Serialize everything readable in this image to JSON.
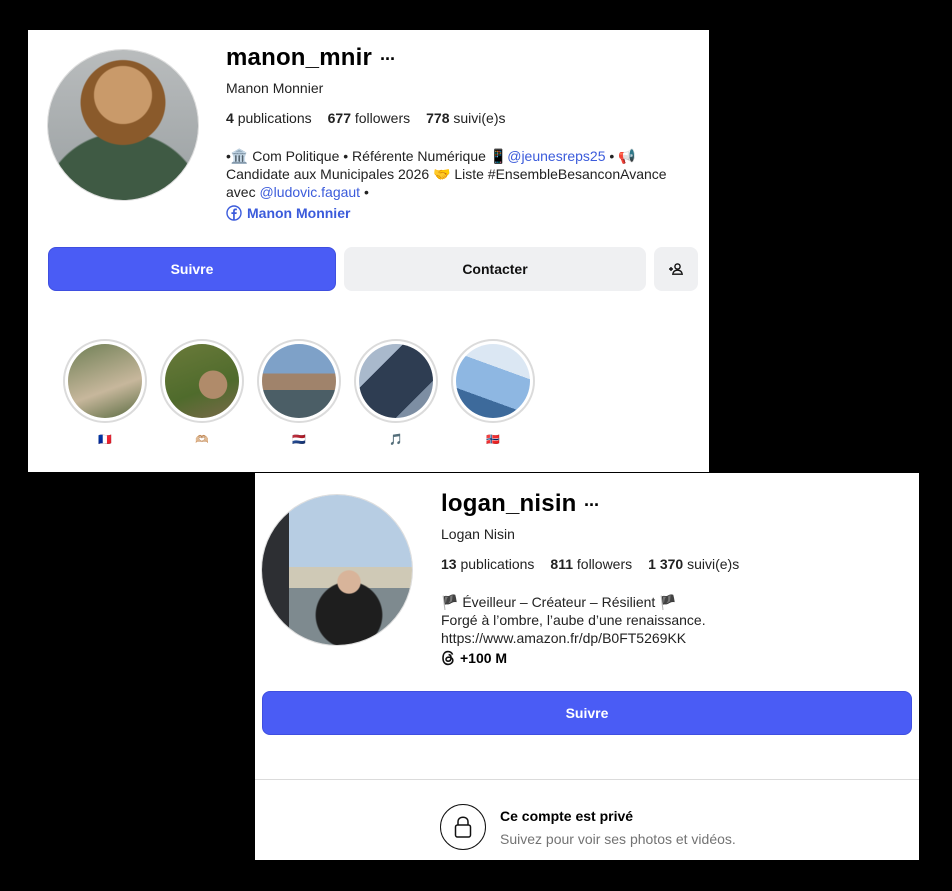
{
  "profile1": {
    "username": "manon_mnir",
    "more": "···",
    "full_name": "Manon Monnier",
    "stats": {
      "publications_count": "4",
      "publications_label": "publications",
      "followers_count": "677",
      "followers_label": "followers",
      "following_count": "778",
      "following_label": "suivi(e)s"
    },
    "bio": {
      "part1": "•🏛️ Com Politique • Référente Numérique 📱",
      "mention1": "@jeunesreps25",
      "part2": " • 📢 Candidate aux Municipales 2026 🤝 Liste #EnsembleBesanconAvance avec ",
      "mention2": "@ludovic.fagaut",
      "part3": " •"
    },
    "external_link": "Manon Monnier",
    "follow_label": "Suivre",
    "contact_label": "Contacter",
    "highlights": [
      {
        "label": "🇫🇷",
        "color1": "#6f7f55",
        "color2": "#c7b79c"
      },
      {
        "label": "🫶🏼",
        "color1": "#4f6b2c",
        "color2": "#b08b6a"
      },
      {
        "label": "🇳🇱",
        "color1": "#7ea1c8",
        "color2": "#4b5e66"
      },
      {
        "label": "🎵",
        "color1": "#2e3d52",
        "color2": "#a9b9cc"
      },
      {
        "label": "🇳🇴",
        "color1": "#8eb7e2",
        "color2": "#dbe7f3"
      }
    ]
  },
  "profile2": {
    "username": "logan_nisin",
    "more": "···",
    "full_name": "Logan Nisin",
    "stats": {
      "publications_count": "13",
      "publications_label": "publications",
      "followers_count": "811",
      "followers_label": "followers",
      "following_count": "1 370",
      "following_label": "suivi(e)s"
    },
    "bio": {
      "line1": "🏴 Éveilleur – Créateur – Résilient 🏴",
      "line2": "Forgé à l’ombre, l’aube d’une renaissance.",
      "line3": "https://www.amazon.fr/dp/B0FT5269KK"
    },
    "threads_label": "+100 M",
    "follow_label": "Suivre",
    "private_title": "Ce compte est privé",
    "private_subtitle": "Suivez pour voir ses photos et vidéos."
  },
  "colors": {
    "primary": "#4a5cf5",
    "link": "#3b5bdb",
    "secondary_bg": "#eff0f2"
  }
}
